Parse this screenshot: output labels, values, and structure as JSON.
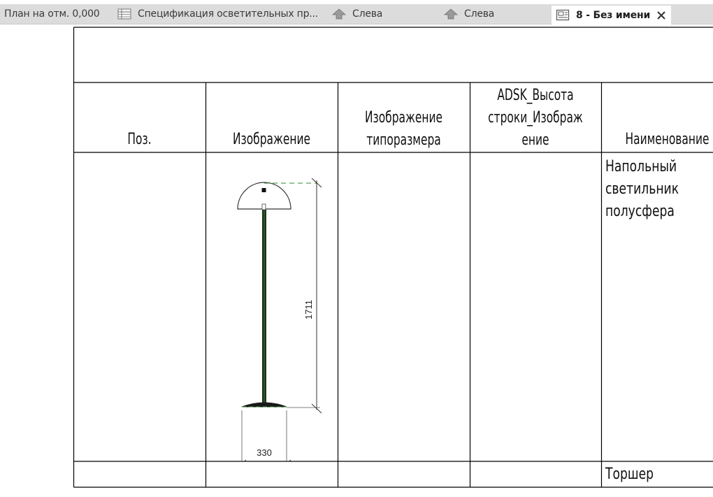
{
  "tabs": [
    {
      "label": "План на отм. 0,000",
      "icon": "floor-plan"
    },
    {
      "label": "Спецификация осветительных пр...",
      "icon": "schedule-table-icon"
    },
    {
      "label": "Слева",
      "icon": "elevation-icon"
    },
    {
      "label": "Слева",
      "icon": "elevation-icon"
    },
    {
      "label": "8 - Без имени",
      "icon": "sheet-icon",
      "active": true
    }
  ],
  "schedule": {
    "columns": [
      "Поз.",
      "Изображение",
      "Изображение типоразмера",
      "ADSK_Высота строки_Изображение",
      "Наименование"
    ],
    "header_lines": {
      "col3": [
        "Изображение",
        "типоразмера"
      ],
      "col4": [
        "ADSK_Высота",
        "строки_Изображ",
        "ение"
      ]
    },
    "rows": [
      {
        "pos": "",
        "image": {
          "type": "floor-lamp",
          "height_dim": "1711",
          "width_dim": "330"
        },
        "type_image": "",
        "row_height": "",
        "name_lines": [
          "Напольный",
          "светильник",
          "полусфера"
        ]
      },
      {
        "pos": "",
        "type_image": "",
        "row_height": "",
        "name_lines": [
          "Торшер"
        ]
      }
    ]
  },
  "colors": {
    "tab_bg": "#dcdcdc",
    "active_tab_bg": "#ffffff",
    "grid_line": "#000000",
    "lamp_green": "#2e8b2e"
  }
}
